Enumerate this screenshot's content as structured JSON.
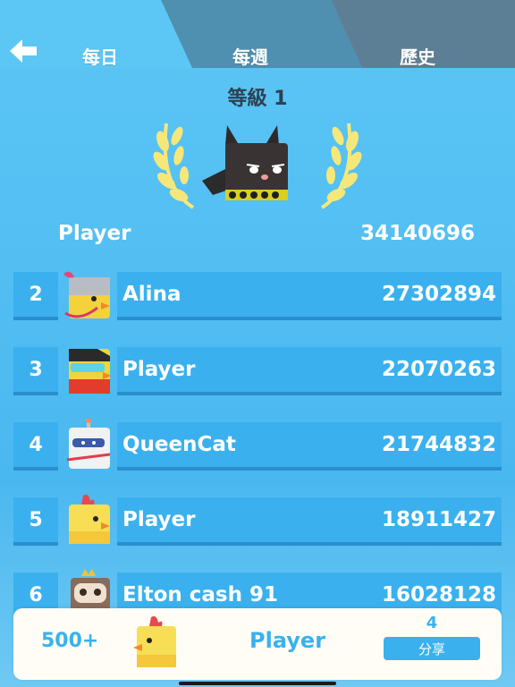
{
  "tabs": [
    {
      "label": "每日",
      "active": true
    },
    {
      "label": "每週",
      "active": false
    },
    {
      "label": "歷史",
      "active": false
    }
  ],
  "hero": {
    "level": "等級 1",
    "name": "Player",
    "score": "34140696",
    "avatar_icon": "bat-character-icon",
    "laurel_color": "#f6e77a"
  },
  "rows": [
    {
      "rank": "2",
      "name": "Alina",
      "score": "27302894",
      "avatar_icon": "knight-bird-icon"
    },
    {
      "rank": "3",
      "name": "Player",
      "score": "22070263",
      "avatar_icon": "goggles-bird-icon"
    },
    {
      "rank": "4",
      "name": "QueenCat",
      "score": "21744832",
      "avatar_icon": "astronaut-bird-icon"
    },
    {
      "rank": "5",
      "name": "Player",
      "score": "18911427",
      "avatar_icon": "yellow-chick-icon"
    },
    {
      "rank": "6",
      "name": "Elton cash 91",
      "score": "16028128",
      "avatar_icon": "king-sloth-icon"
    }
  ],
  "me": {
    "rank": "500+",
    "name": "Player",
    "count": "4",
    "share_label": "分享",
    "avatar_icon": "yellow-chick-icon"
  },
  "colors": {
    "background": "#5cc6f5",
    "row": "#3ab1ee",
    "accent": "#3ab1ee"
  }
}
